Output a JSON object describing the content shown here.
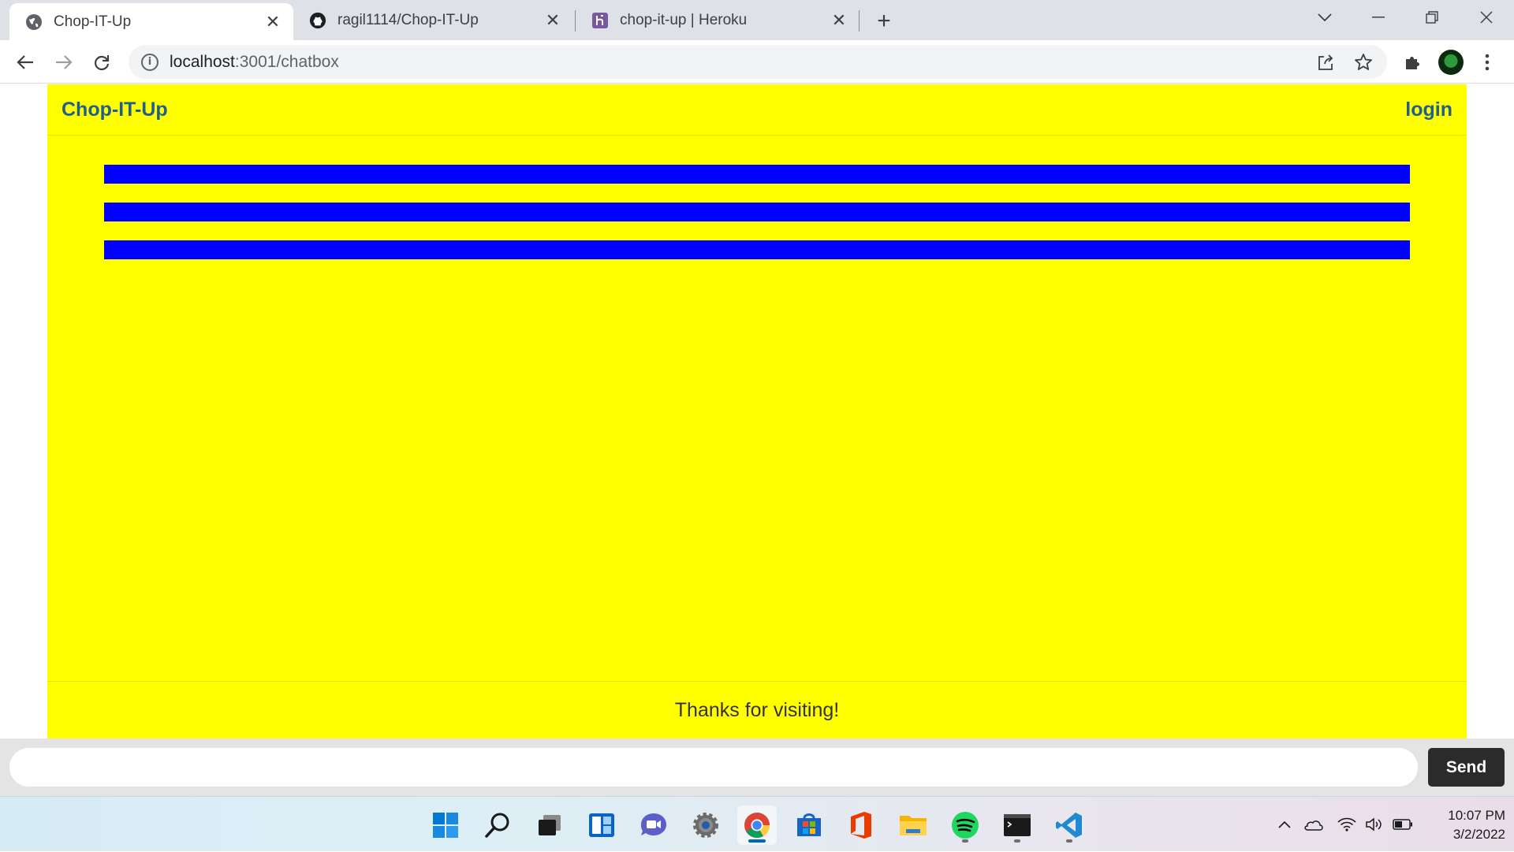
{
  "browser": {
    "tabs": [
      {
        "title": "Chop-IT-Up",
        "favicon": "globe-icon",
        "active": true
      },
      {
        "title": "ragil1114/Chop-IT-Up",
        "favicon": "github-icon",
        "active": false
      },
      {
        "title": "chop-it-up | Heroku",
        "favicon": "heroku-icon",
        "active": false
      }
    ],
    "url_host": "localhost",
    "url_rest": ":3001/chatbox"
  },
  "page": {
    "brand": "Chop-IT-Up",
    "login_label": "login",
    "footer_text": "Thanks for visiting!",
    "background_color": "#ffff00",
    "bar_color": "#0000ff",
    "message_bar_count": 3
  },
  "chat": {
    "input_value": "",
    "send_label": "Send"
  },
  "taskbar": {
    "apps": [
      "windows-start-icon",
      "search-icon",
      "task-view-icon",
      "widgets-icon",
      "teams-chat-icon",
      "settings-icon",
      "chrome-icon",
      "microsoft-store-icon",
      "office-icon",
      "file-explorer-icon",
      "spotify-icon",
      "terminal-icon",
      "vscode-icon"
    ],
    "time": "10:07 PM",
    "date": "3/2/2022"
  }
}
